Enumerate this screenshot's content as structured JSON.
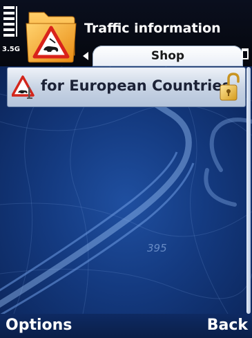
{
  "status": {
    "network_type": "3.5G",
    "signal_bars": 6,
    "battery_level": 0.1
  },
  "header": {
    "app_title": "Traffic information",
    "app_icon": "traffic-warning-folder-icon"
  },
  "tabs": {
    "active_label": "Shop",
    "left_arrow_icon": "left-arrow-icon"
  },
  "list": {
    "items": [
      {
        "label": "for European Countries",
        "leading_icon": "warning-sign-icon",
        "trailing_icon": "open-lock-icon"
      }
    ]
  },
  "map": {
    "road_number": "395"
  },
  "softkeys": {
    "left": "Options",
    "right": "Back"
  },
  "colors": {
    "background_blue": "#143a80",
    "list_item_bg": "#c6d2e3",
    "tab_bg": "#ffffff"
  }
}
